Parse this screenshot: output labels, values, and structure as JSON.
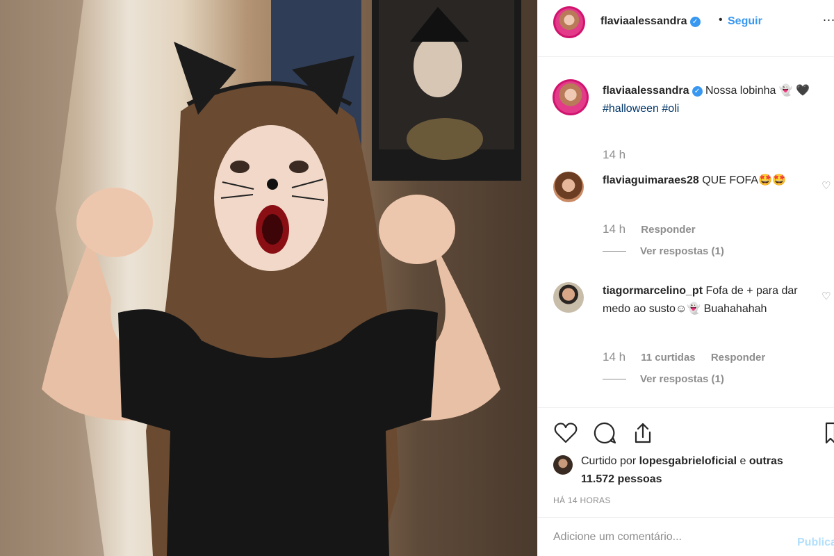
{
  "post": {
    "image_alt": "",
    "author": {
      "username": "flaviaalessandra",
      "verified_icon": "check-icon"
    },
    "header": {
      "separator": "•",
      "follow_label": "Seguir",
      "more_label": "..."
    },
    "caption": {
      "username": "flaviaalessandra",
      "text": "Nossa lobinha 👻 🖤",
      "hashtags": "#halloween #oli",
      "time": "14 h"
    },
    "comments": [
      {
        "username": "flaviaguimaraes28",
        "text": "QUE FOFA🤩🤩",
        "time": "14 h",
        "likes": "",
        "reply_label": "Responder",
        "view_replies": "Ver respostas (1)"
      },
      {
        "username": "tiagormarcelino_pt",
        "text": "Fofa de + para dar medo ao susto☺👻 Buahahahah",
        "time": "14 h",
        "likes": "11 curtidas",
        "reply_label": "Responder",
        "view_replies": "Ver respostas (1)"
      }
    ],
    "likes": {
      "prefix": "Curtido por",
      "user": "lopesgabrieloficial",
      "connector": "e",
      "others": "outras 11.572 pessoas"
    },
    "time_ago": "HÁ 14 HORAS",
    "add_comment": {
      "placeholder": "Adicione um comentário...",
      "publish_label": "Publicar"
    },
    "colors": {
      "link": "#3897f0",
      "hashtag": "#003569",
      "muted": "#8e8e8e",
      "publish_disabled": "#b2dffc"
    }
  }
}
